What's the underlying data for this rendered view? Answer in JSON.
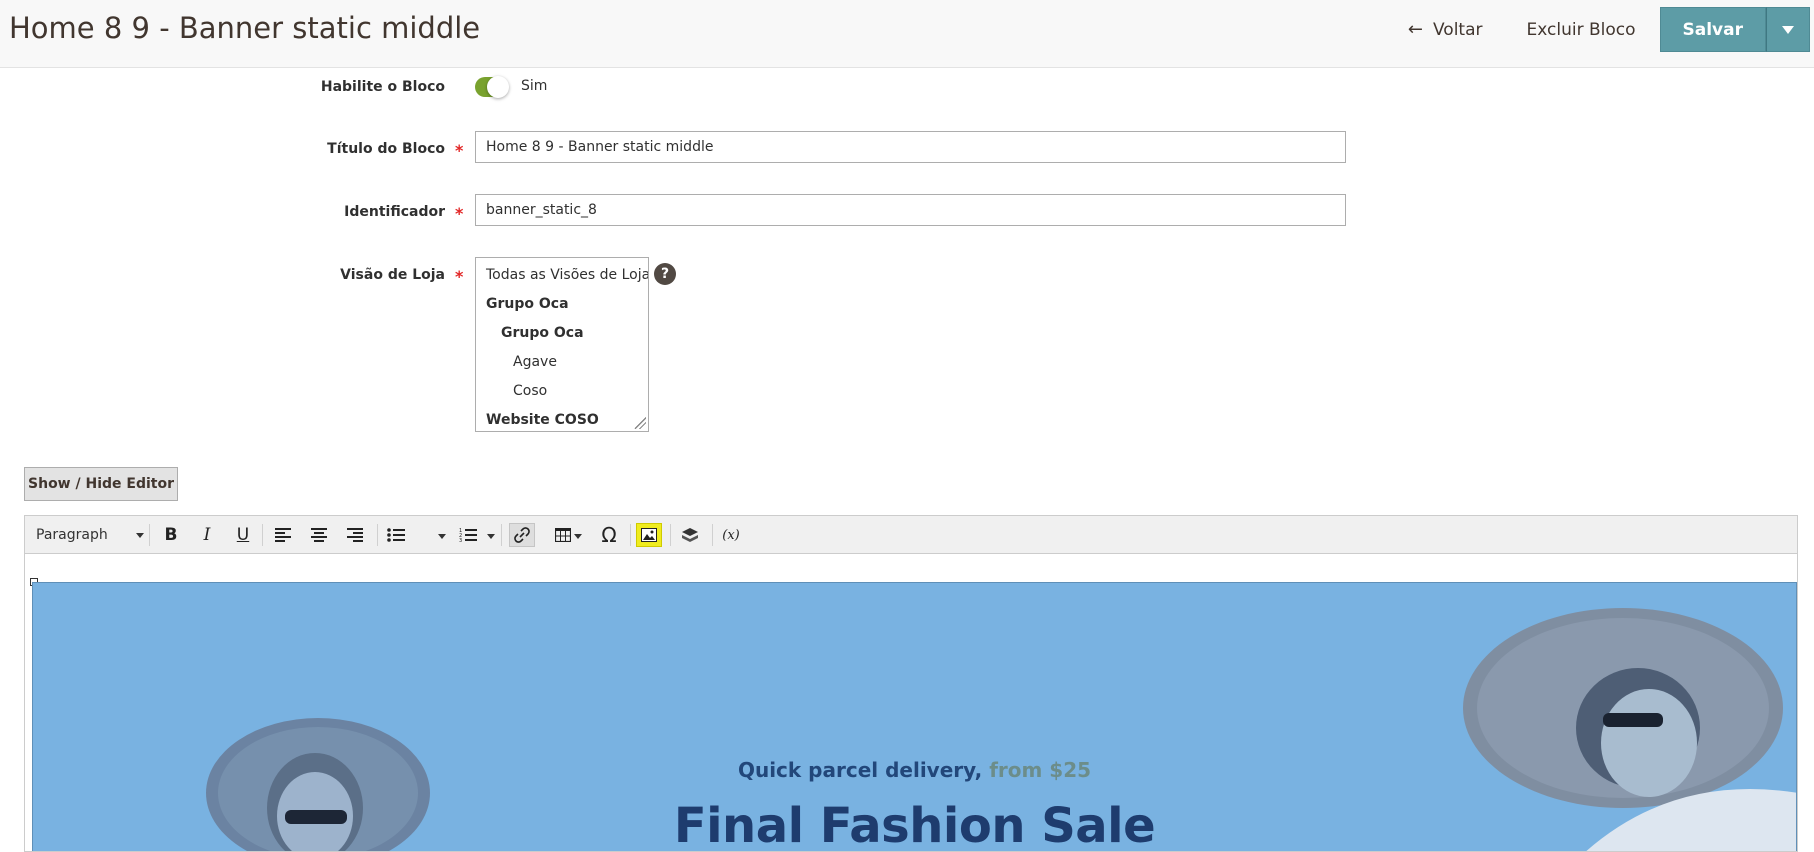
{
  "header": {
    "title": "Home 8 9 - Banner static middle",
    "back_label": "Voltar",
    "delete_label": "Excluir Bloco",
    "save_label": "Salvar"
  },
  "form": {
    "enable": {
      "label": "Habilite o Bloco",
      "value_text": "Sim",
      "enabled": true
    },
    "title": {
      "label": "Título do Bloco",
      "required": "*",
      "value": "Home 8 9 - Banner static middle"
    },
    "identifier": {
      "label": "Identificador",
      "required": "*",
      "value": "banner_static_8"
    },
    "store_view": {
      "label": "Visão de Loja",
      "required": "*",
      "help": "?",
      "options": [
        {
          "label": "Todas as Visões de Loja",
          "bold": false,
          "indent": 0
        },
        {
          "label": "Grupo Oca",
          "bold": true,
          "indent": 0
        },
        {
          "label": "Grupo Oca",
          "bold": true,
          "indent": 1
        },
        {
          "label": "Agave",
          "bold": false,
          "indent": 2
        },
        {
          "label": "Coso",
          "bold": false,
          "indent": 2
        },
        {
          "label": "Website COSO",
          "bold": true,
          "indent": 0
        }
      ]
    }
  },
  "editor": {
    "toggle_label": "Show / Hide Editor",
    "format_label": "Paragraph",
    "toolbar_icons": [
      "bold-icon",
      "italic-icon",
      "underline-icon",
      "align-left-icon",
      "align-center-icon",
      "align-right-icon",
      "bullet-list-icon",
      "numbered-list-icon",
      "link-icon",
      "table-icon",
      "special-char-icon",
      "image-icon",
      "widget-icon",
      "variable-icon"
    ]
  },
  "banner": {
    "subtitle_main": "Quick parcel delivery, ",
    "subtitle_accent": "from $25",
    "title": "Final Fashion Sale",
    "bg_color": "#79b2e1"
  }
}
